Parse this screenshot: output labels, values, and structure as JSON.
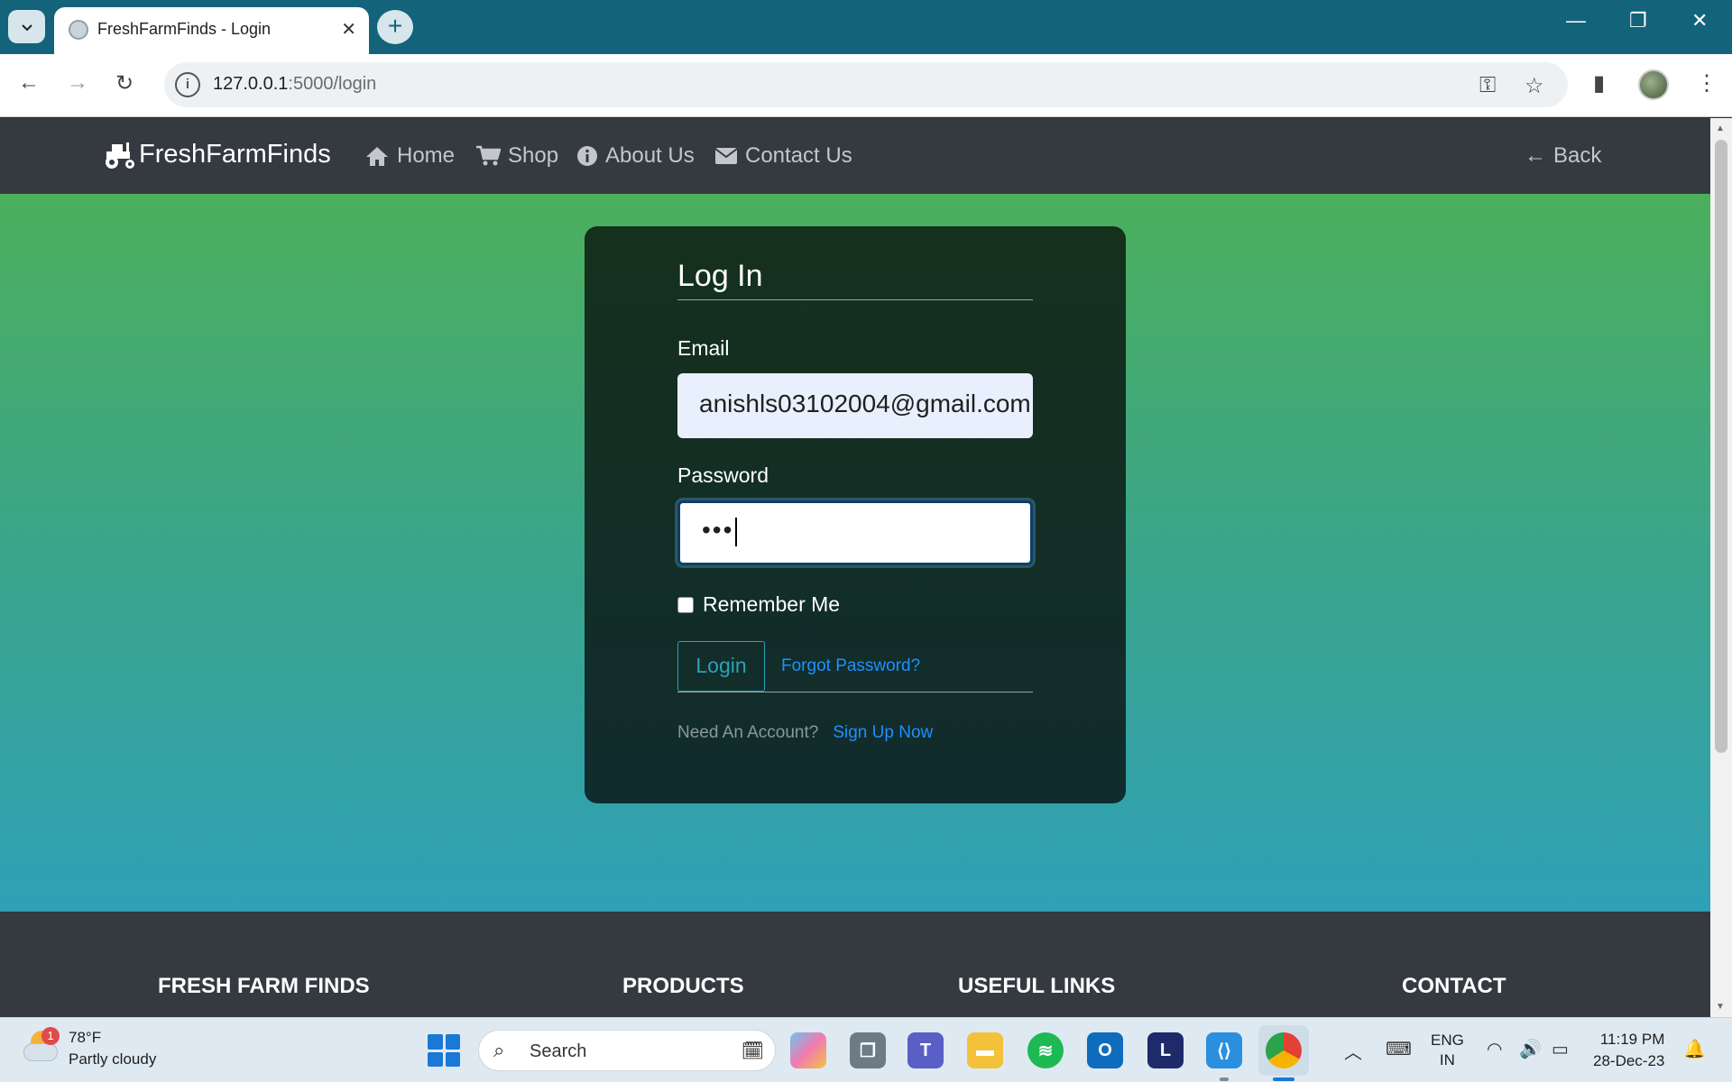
{
  "browser": {
    "tab_title": "FreshFarmFinds - Login",
    "url_host": "127.0.0.1",
    "url_path": ":5000/login",
    "icons": [
      "tab-search-icon",
      "favicon-icon",
      "close-icon",
      "new-tab-icon",
      "back-icon",
      "forward-icon",
      "reload-icon",
      "site-info-icon",
      "password-key-icon",
      "bookmark-star-icon",
      "side-panel-icon",
      "profile-avatar",
      "menu-dots-icon"
    ]
  },
  "site": {
    "brand": "FreshFarmFinds",
    "nav": {
      "home": "Home",
      "shop": "Shop",
      "about": "About Us",
      "contact": "Contact Us",
      "back": "Back"
    }
  },
  "login": {
    "title": "Log In",
    "email_label": "Email",
    "email_value": "anishls03102004@gmail.com",
    "password_label": "Password",
    "password_value": "•••",
    "remember_label": "Remember Me",
    "login_button": "Login",
    "forgot_link": "Forgot Password?",
    "need_account": "Need An Account?",
    "signup_link": "Sign Up Now"
  },
  "footer": {
    "col1": "FRESH FARM FINDS",
    "col2": "PRODUCTS",
    "col3": "USEFUL LINKS",
    "col4": "CONTACT"
  },
  "taskbar": {
    "weather_badge": "1",
    "temperature": "78°F",
    "condition": "Partly cloudy",
    "search_placeholder": "Search",
    "lang_line1": "ENG",
    "lang_line2": "IN",
    "time": "11:19 PM",
    "date": "28-Dec-23"
  },
  "colors": {
    "nav_bg": "#343a40",
    "hero_top": "#4caf5c",
    "hero_bottom": "#2fa0b6",
    "card_bg": "#13302a",
    "link": "#1e90ff",
    "button_outline": "#2aa3b8",
    "chrome_tabbar": "#13637a"
  }
}
